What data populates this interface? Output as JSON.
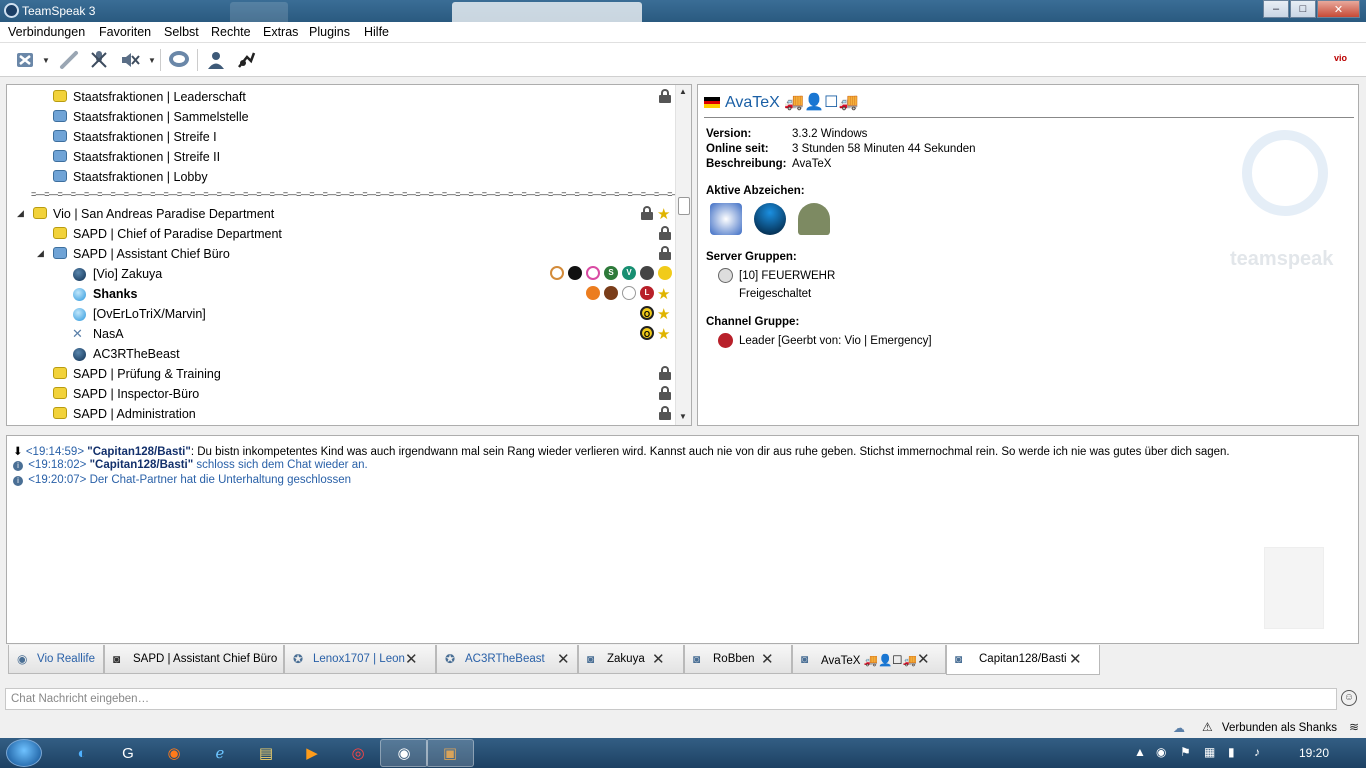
{
  "window": {
    "title": "TeamSpeak 3",
    "controls": {
      "minimize": "–",
      "maximize": "□",
      "close": "✕"
    }
  },
  "menu": [
    {
      "label": "Verbindungen"
    },
    {
      "label": "Favoriten"
    },
    {
      "label": "Selbst"
    },
    {
      "label": "Rechte"
    },
    {
      "label": "Extras"
    },
    {
      "label": "Plugins"
    },
    {
      "label": "Hilfe"
    }
  ],
  "toolbar": {
    "icons": [
      "disconnect-icon",
      "away-icon",
      "mute-microphone-icon",
      "mute-speakers-icon",
      "chat-icon",
      "contacts-icon",
      "whisper-icon"
    ],
    "brand_logo": "vio"
  },
  "tree": {
    "rows": [
      {
        "label": "Staatsfraktionen | Leaderschaft",
        "type": "channel",
        "color": "yellow",
        "locked": true
      },
      {
        "label": "Staatsfraktionen | Sammelstelle",
        "type": "channel",
        "color": "blue"
      },
      {
        "label": "Staatsfraktionen | Streife I",
        "type": "channel",
        "color": "blue"
      },
      {
        "label": "Staatsfraktionen | Streife II",
        "type": "channel",
        "color": "blue"
      },
      {
        "label": "Staatsfraktionen | Lobby",
        "type": "channel",
        "color": "blue"
      },
      {
        "label": "Vio | San Andreas Paradise Department",
        "type": "channel",
        "color": "yellow",
        "locked": true,
        "starred": true
      },
      {
        "label": "SAPD | Chief of Paradise Department",
        "type": "channel",
        "color": "yellow",
        "locked": true
      },
      {
        "label": "SAPD | Assistant Chief Büro",
        "type": "channel",
        "color": "blue",
        "locked": true
      },
      {
        "label": "[Vio] Zakuya",
        "type": "user",
        "dot": "dark"
      },
      {
        "label": "Shanks",
        "type": "user",
        "dot": "light",
        "bold": true
      },
      {
        "label": "[OvErLoTriX/Marvin]",
        "type": "user",
        "dot": "light"
      },
      {
        "label": "NasA",
        "type": "user",
        "dot": "mic"
      },
      {
        "label": "AC3RTheBeast",
        "type": "user",
        "dot": "dark"
      },
      {
        "label": "SAPD | Prüfung & Training",
        "type": "channel",
        "color": "yellow",
        "locked": true
      },
      {
        "label": "SAPD | Inspector-Büro",
        "type": "channel",
        "color": "yellow",
        "locked": true
      },
      {
        "label": "SAPD | Administration",
        "type": "channel",
        "color": "yellow",
        "locked": true
      }
    ],
    "spacer": "=—=—=—=—=—=—=—=—=—=—=—=—=—=—=—=—=—=—=—=—=—=—=—=—=—=—=—=—=—=—=—=—=—=—=—=—=—=—=—=—=—=—=—=—=—=—=—=—=—=—=—=—=—=—=—=—=—=—="
  },
  "info": {
    "name": "AvaTeX 🚚👤☐🚚",
    "version_label": "Version:",
    "version_value": "3.3.2 Windows",
    "online_label": "Online seit:",
    "online_value": "3 Stunden 58 Minuten 44 Sekunden",
    "description_label": "Beschreibung:",
    "description_value": "AvaTeX",
    "badges_heading": "Aktive Abzeichen:",
    "server_groups_heading": "Server Gruppen:",
    "server_group_1": "[10] FEUERWEHR",
    "server_group_2": "Freigeschaltet",
    "channel_group_heading": "Channel Gruppe:",
    "channel_group_value": "Leader [Geerbt von: Vio | Emergency]",
    "watermark": "teamspeak"
  },
  "chat": {
    "lines": [
      {
        "ts": "<19:14:59>",
        "nick": "\"Capitan128/Basti\"",
        "text": ": Du bistn inkompetentes Kind was auch irgendwann mal sein Rang wieder verlieren wird. Kannst auch nie von dir aus ruhe geben. Stichst immernochmal rein. So werde ich nie was gutes über dich sagen."
      },
      {
        "ts": "<19:18:02>",
        "nick": "\"Capitan128/Basti\"",
        "text": " schloss sich dem Chat wieder an."
      },
      {
        "ts": "<19:20:07>",
        "nick": "",
        "text": " Der Chat-Partner hat die Unterhaltung geschlossen"
      }
    ]
  },
  "tabs": [
    {
      "label": "Vio Reallife"
    },
    {
      "label": "SAPD | Assistant Chief Büro"
    },
    {
      "label": "Lenox1707 | Leon"
    },
    {
      "label": "AC3RTheBeast"
    },
    {
      "label": "Zakuya"
    },
    {
      "label": "RoBben"
    },
    {
      "label": "AvaTeX 🚚👤☐🚚"
    },
    {
      "label": "Capitan128/Basti"
    }
  ],
  "chat_input": {
    "placeholder": "Chat Nachricht eingeben…"
  },
  "status": {
    "text": "Verbunden als Shanks"
  },
  "taskbar": {
    "clock": "19:20"
  }
}
